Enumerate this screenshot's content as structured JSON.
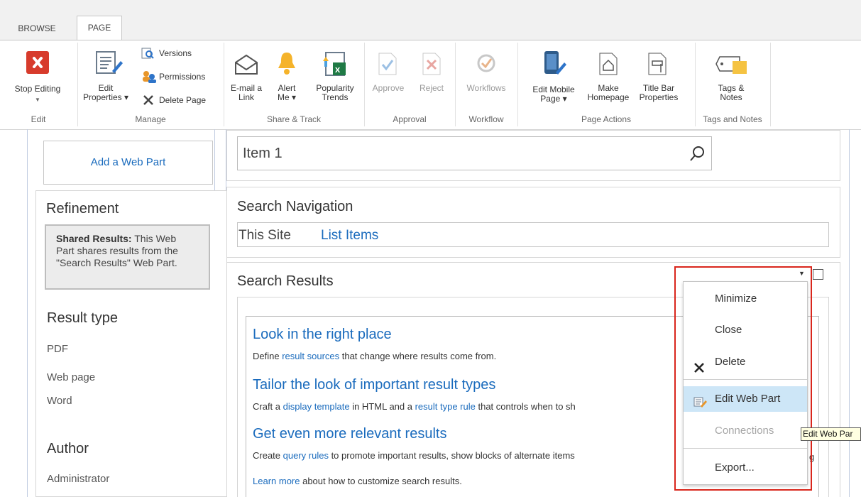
{
  "ribbon": {
    "tabs": [
      "BROWSE",
      "PAGE"
    ],
    "groups": {
      "edit": {
        "label": "Edit",
        "stop_editing": "Stop Editing"
      },
      "manage": {
        "label": "Manage",
        "edit_properties_1": "Edit",
        "edit_properties_2": "Properties",
        "versions": "Versions",
        "permissions": "Permissions",
        "delete_page": "Delete Page"
      },
      "share": {
        "label": "Share & Track",
        "email_1": "E-mail a",
        "email_2": "Link",
        "alert_1": "Alert",
        "alert_2": "Me",
        "pop_1": "Popularity",
        "pop_2": "Trends"
      },
      "approval": {
        "label": "Approval",
        "approve": "Approve",
        "reject": "Reject"
      },
      "workflow": {
        "label": "Workflow",
        "workflows": "Workflows"
      },
      "page_actions": {
        "label": "Page Actions",
        "mobile_1": "Edit Mobile",
        "mobile_2": "Page",
        "home_1": "Make",
        "home_2": "Homepage",
        "title_1": "Title Bar",
        "title_2": "Properties"
      },
      "tags": {
        "label": "Tags and Notes",
        "tags_1": "Tags &",
        "tags_2": "Notes"
      }
    }
  },
  "left": {
    "add_web_part": "Add a Web Part",
    "refinement_title": "Refinement",
    "shared_bold": "Shared Results:",
    "shared_text_1": " This Web",
    "shared_text_2": "Part shares results from the",
    "shared_text_3": "\"Search Results\" Web Part.",
    "result_type_title": "Result type",
    "result_types": [
      "PDF",
      "Web page",
      "Word"
    ],
    "author_title": "Author",
    "authors": [
      "Administrator"
    ]
  },
  "search": {
    "query_value": "Item 1"
  },
  "search_navigation": {
    "title": "Search Navigation",
    "items": [
      "This Site",
      "List Items"
    ]
  },
  "search_results": {
    "title": "Search Results",
    "tips": [
      {
        "heading": "Look in the right place",
        "pre": "Define ",
        "link": "result sources",
        "post": " that change where results come from."
      },
      {
        "heading": "Tailor the look of important result types",
        "pre": "Craft a ",
        "link": "display template",
        "mid": " in HTML and a ",
        "link2": "result type rule",
        "post": " that controls when to sh"
      },
      {
        "heading": "Get even more relevant results",
        "pre": "Create ",
        "link": "query rules",
        "post": " to promote important results, show blocks of alternate items",
        "tail": "g"
      }
    ],
    "learn_more_link": "Learn more",
    "learn_more_text": " about how to customize search results."
  },
  "context_menu": {
    "items": [
      {
        "label": "Minimize",
        "icon": ""
      },
      {
        "label": "Close",
        "icon": ""
      },
      {
        "label": "Delete",
        "icon": "x-icon"
      },
      {
        "label": "Edit Web Part",
        "icon": "edit-web-part-icon",
        "highlighted": true
      },
      {
        "label": "Connections",
        "icon": "",
        "disabled": true
      },
      {
        "label": "Export...",
        "icon": ""
      }
    ]
  },
  "tooltip": "Edit Web Par",
  "colors": {
    "accent_link": "#1a6bbd",
    "highlight_box": "#d9261c",
    "menu_hover": "#cde6f7"
  }
}
